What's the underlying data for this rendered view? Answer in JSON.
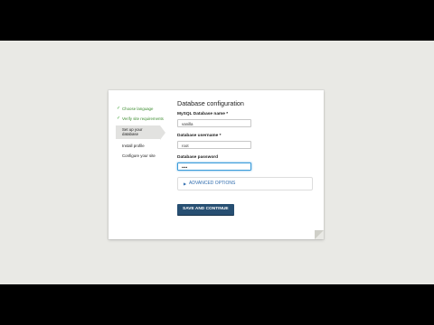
{
  "steps": [
    {
      "label": "Choose language",
      "status": "done"
    },
    {
      "label": "Verify site requirements",
      "status": "done"
    },
    {
      "label": "Set up your database",
      "status": "active"
    },
    {
      "label": "Install profile",
      "status": "pending"
    },
    {
      "label": "Configure your site",
      "status": "pending"
    }
  ],
  "form": {
    "title": "Database configuration",
    "db_name_label": "MySQL Database name *",
    "db_name_value": "vanilla",
    "db_user_label": "Database username *",
    "db_user_value": "root",
    "db_pass_label": "Database password",
    "db_pass_value": "••••",
    "advanced_label": "ADVANCED OPTIONS",
    "submit_label": "SAVE AND CONTINUE"
  },
  "colors": {
    "done_text": "#3a8b2d",
    "link": "#2f6cae",
    "button": "#274f72",
    "focus": "#3a9bd9"
  },
  "icons": {
    "check": "check-icon",
    "disclosure": "triangle-right-icon"
  }
}
